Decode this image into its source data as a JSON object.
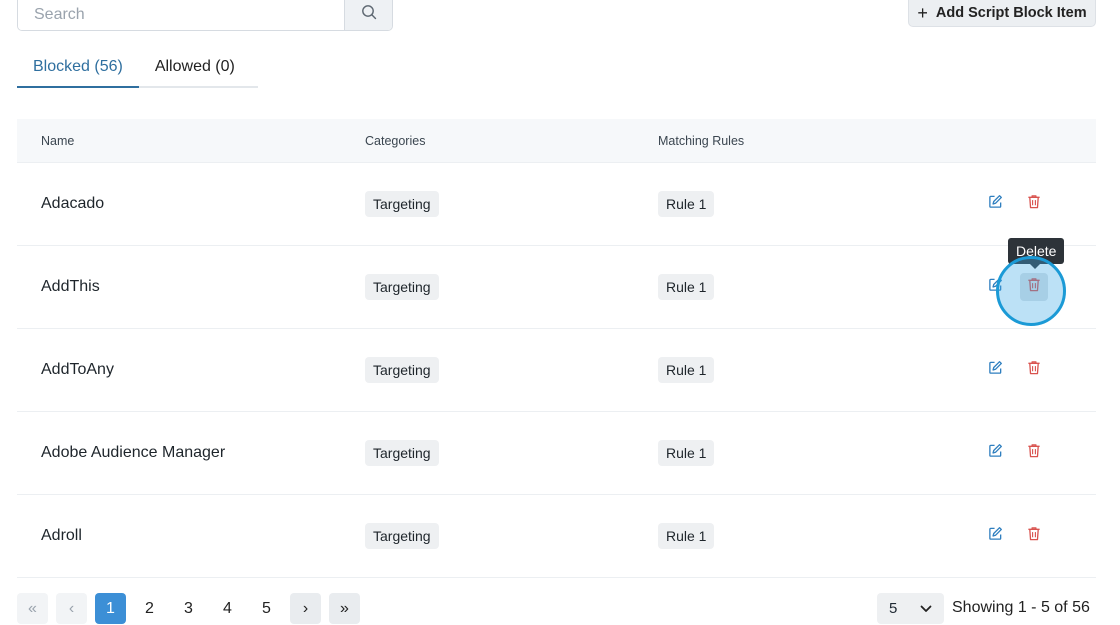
{
  "search": {
    "placeholder": "Search",
    "icon": "search-icon"
  },
  "toolbar": {
    "add_plus": "+",
    "add_label": "Add Script Block Item"
  },
  "tabs": [
    {
      "label": "Blocked (56)",
      "active": true
    },
    {
      "label": "Allowed (0)",
      "active": false
    }
  ],
  "table": {
    "columns": [
      "Name",
      "Categories",
      "Matching Rules"
    ],
    "rows": [
      {
        "name": "Adacado",
        "category": "Targeting",
        "rule": "Rule 1"
      },
      {
        "name": "AddThis",
        "category": "Targeting",
        "rule": "Rule 1"
      },
      {
        "name": "AddToAny",
        "category": "Targeting",
        "rule": "Rule 1"
      },
      {
        "name": "Adobe Audience Manager",
        "category": "Targeting",
        "rule": "Rule 1"
      },
      {
        "name": "Adroll",
        "category": "Targeting",
        "rule": "Rule 1"
      }
    ]
  },
  "tooltip": {
    "text": "Delete"
  },
  "pagination": {
    "first": "«",
    "prev": "‹",
    "next": "›",
    "last": "»",
    "pages": [
      "1",
      "2",
      "3",
      "4",
      "5"
    ],
    "current": "1"
  },
  "per_page": {
    "value": "5"
  },
  "showing_text": "Showing 1 - 5 of 56",
  "colors": {
    "accent": "#2f6f9f",
    "current_page": "#3c8fd6",
    "edit_icon": "#2f7fbf",
    "delete_icon": "#d9534f"
  }
}
